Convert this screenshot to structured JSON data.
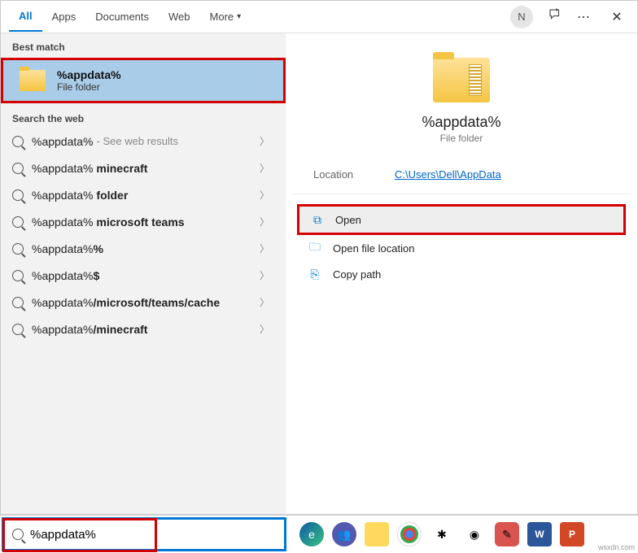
{
  "tabs": {
    "all": "All",
    "apps": "Apps",
    "documents": "Documents",
    "web": "Web",
    "more": "More"
  },
  "avatar_initial": "N",
  "section": {
    "best": "Best match",
    "web": "Search the web"
  },
  "best_match": {
    "title": "%appdata%",
    "subtitle": "File folder"
  },
  "web_results": [
    {
      "prefix": "%appdata%",
      "bold": "",
      "hint": " - See web results"
    },
    {
      "prefix": "%appdata%",
      "bold": " minecraft",
      "hint": ""
    },
    {
      "prefix": "%appdata%",
      "bold": " folder",
      "hint": ""
    },
    {
      "prefix": "%appdata%",
      "bold": " microsoft teams",
      "hint": ""
    },
    {
      "prefix": "%appdata%",
      "bold": "%",
      "hint": ""
    },
    {
      "prefix": "%appdata%",
      "bold": "$",
      "hint": ""
    },
    {
      "prefix": "%appdata%",
      "bold": "/microsoft/teams/cache",
      "hint": ""
    },
    {
      "prefix": "%appdata%",
      "bold": "/minecraft",
      "hint": ""
    }
  ],
  "preview": {
    "title": "%appdata%",
    "subtitle": "File folder",
    "location_label": "Location",
    "location_value": "C:\\Users\\Dell\\AppData"
  },
  "actions": {
    "open": "Open",
    "open_loc": "Open file location",
    "copy": "Copy path"
  },
  "search_value": "%appdata%",
  "watermark": "wsxdn.com",
  "word_label": "W",
  "pp_label": "P"
}
